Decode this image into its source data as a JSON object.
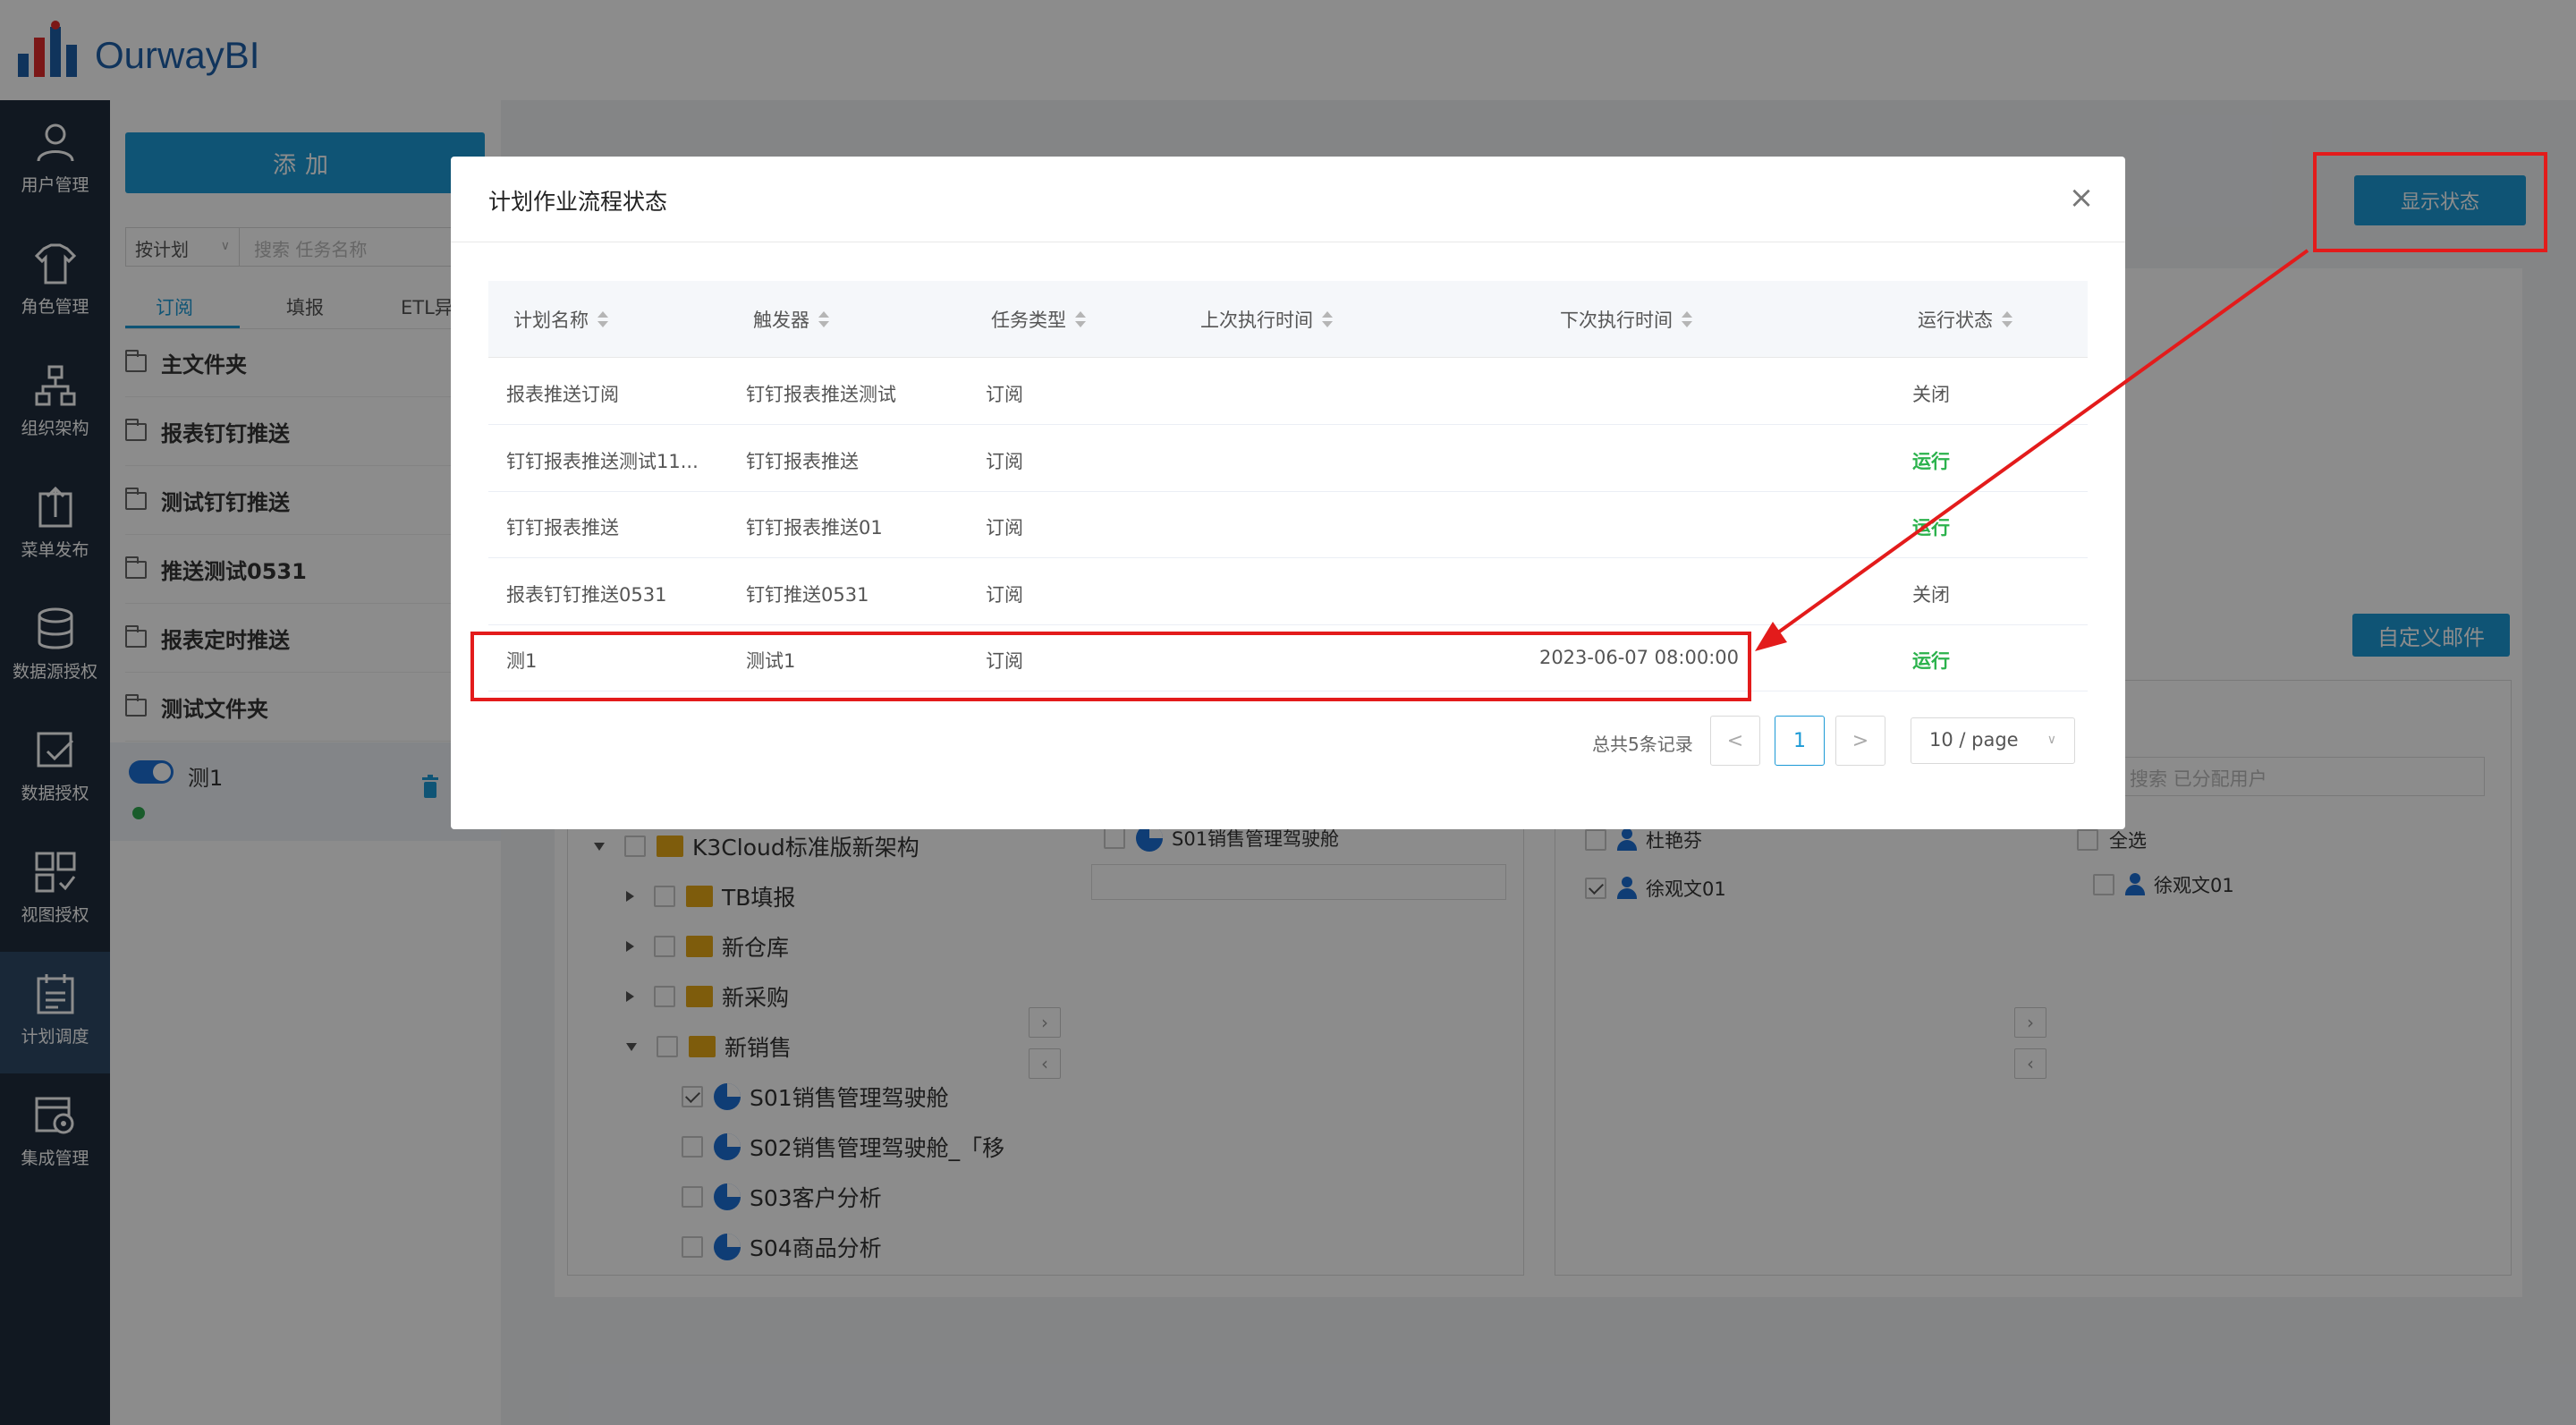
{
  "app": {
    "logo_text": "OurwayBI"
  },
  "left_nav": [
    {
      "key": "user",
      "label": "用户管理",
      "icon": "user-icon"
    },
    {
      "key": "role",
      "label": "角色管理",
      "icon": "shirt-icon"
    },
    {
      "key": "org",
      "label": "组织架构",
      "icon": "org-chart-icon"
    },
    {
      "key": "menu",
      "label": "菜单发布",
      "icon": "upload-icon"
    },
    {
      "key": "datasource",
      "label": "数据源授权",
      "icon": "database-icon"
    },
    {
      "key": "data",
      "label": "数据授权",
      "icon": "check-board-icon"
    },
    {
      "key": "view",
      "label": "视图授权",
      "icon": "grid-icon"
    },
    {
      "key": "schedule",
      "label": "计划调度",
      "icon": "calendar-icon",
      "active": true
    },
    {
      "key": "integration",
      "label": "集成管理",
      "icon": "integration-icon"
    }
  ],
  "tree_panel": {
    "add_label": "添加",
    "filter_select": "按计划",
    "search_placeholder": "搜索 任务名称",
    "subtabs": [
      "订阅",
      "填报",
      "ETL异"
    ],
    "folders": [
      "主文件夹",
      "报表钉钉推送",
      "测试钉钉推送",
      "推送测试0531",
      "报表定时推送",
      "测试文件夹"
    ],
    "task": {
      "name": "测1"
    }
  },
  "main": {
    "show_status_label": "显示状态",
    "custom_mail_label": "自定义邮件",
    "left_tree": {
      "root": "K3Cloud标准版新架构",
      "nodes": [
        "TB填报",
        "新仓库",
        "新采购",
        "新销售"
      ],
      "leaves": [
        "S01销售管理驾驶舱",
        "S02销售管理驾驶舱_「移",
        "S03客户分析",
        "S04商品分析"
      ]
    },
    "middle_selected": "S01销售管理驾驶舱",
    "right": {
      "search_placeholder": "搜索 已分配用户",
      "users_left": [
        "杜艳芬",
        "徐观文01"
      ],
      "select_all": "全选",
      "users_right": [
        "徐观文01"
      ]
    }
  },
  "modal": {
    "title": "计划作业流程状态",
    "close": "×",
    "columns": [
      "计划名称",
      "触发器",
      "任务类型",
      "上次执行时间",
      "下次执行时间",
      "运行状态"
    ],
    "rows": [
      {
        "name": "报表推送订阅",
        "trigger": "钉钉报表推送测试",
        "type": "订阅",
        "last": "",
        "next": "",
        "status": "关闭",
        "running": false
      },
      {
        "name": "钉钉报表推送测试11...",
        "trigger": "钉钉报表推送",
        "type": "订阅",
        "last": "",
        "next": "",
        "status": "运行",
        "running": true
      },
      {
        "name": "钉钉报表推送",
        "trigger": "钉钉报表推送01",
        "type": "订阅",
        "last": "",
        "next": "",
        "status": "运行",
        "running": true
      },
      {
        "name": "报表钉钉推送0531",
        "trigger": "钉钉推送0531",
        "type": "订阅",
        "last": "",
        "next": "",
        "status": "关闭",
        "running": false
      },
      {
        "name": "测1",
        "trigger": "测试1",
        "type": "订阅",
        "last": "",
        "next": "2023-06-07 08:00:00",
        "status": "运行",
        "running": true
      }
    ],
    "pagination": {
      "total_text": "总共5条记录",
      "prev": "<",
      "current": "1",
      "next": ">",
      "page_size": "10 / page"
    }
  },
  "colors": {
    "accent": "#1c9ad6",
    "nav_bg": "#1f2d3d",
    "running": "#2bb24c",
    "annotation": "#e31b1b"
  }
}
